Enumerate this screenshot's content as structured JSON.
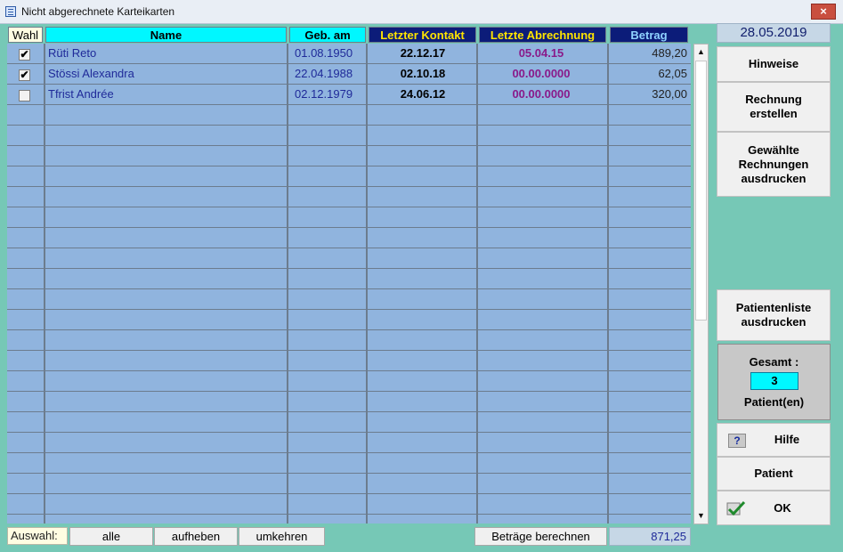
{
  "window": {
    "title": "Nicht abgerechnete Karteikarten",
    "close": "×"
  },
  "columns": {
    "wahl": "Wahl",
    "name": "Name",
    "geb": "Geb. am",
    "kontakt": "Letzter Kontakt",
    "abrechnung": "Letzte Abrechnung",
    "betrag": "Betrag"
  },
  "rows": [
    {
      "checked": true,
      "name": "Rüti Reto",
      "geb": "01.08.1950",
      "kontakt": "22.12.17",
      "abrechnung": "05.04.15",
      "betrag": "489,20"
    },
    {
      "checked": true,
      "name": "Stössi Alexandra",
      "geb": "22.04.1988",
      "kontakt": "02.10.18",
      "abrechnung": "00.00.0000",
      "betrag": "62,05"
    },
    {
      "checked": false,
      "name": "Tfrist Andrée",
      "geb": "02.12.1979",
      "kontakt": "24.06.12",
      "abrechnung": "00.00.0000",
      "betrag": "320,00"
    }
  ],
  "side": {
    "date": "28.05.2019",
    "hinweise": "Hinweise",
    "rechnung_erstellen": "Rechnung\nerstellen",
    "gewaehlte_rechnungen": "Gewählte\nRechnungen\nausdrucken",
    "patientenliste": "Patientenliste\nausdrucken",
    "gesamt_label": "Gesamt :",
    "gesamt_value": "3",
    "gesamt_unit": "Patient(en)",
    "hilfe": "Hilfe",
    "hilfe_icon": "?",
    "patient": "Patient",
    "ok": "OK"
  },
  "bottom": {
    "auswahl_label": "Auswahl:",
    "alle": "alle",
    "aufheben": "aufheben",
    "umkehren": "umkehren",
    "berechnen": "Beträge berechnen",
    "total": "871,25"
  },
  "scrollbar": {
    "up": "▲",
    "down": "▼"
  },
  "colors": {
    "background": "#76c8b6",
    "grid": "#90b4de",
    "header_cyan": "#00f7ff",
    "header_navy": "#0c1c79"
  },
  "icons": {
    "window": "list-window-icon",
    "help": "question-icon",
    "ok": "checkmark-icon",
    "close": "close-icon"
  }
}
